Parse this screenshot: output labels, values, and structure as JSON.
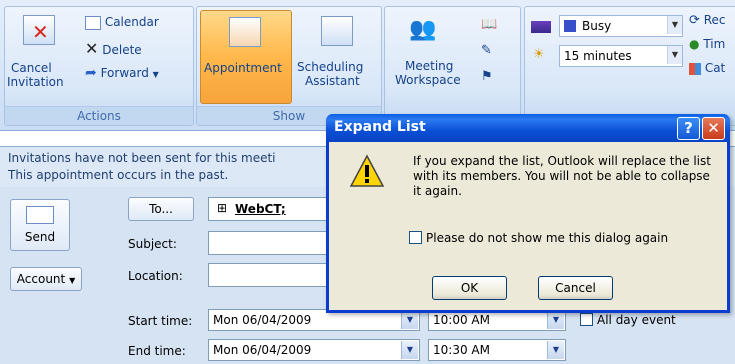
{
  "ribbon": {
    "actions": {
      "cancel_label_1": "Cancel",
      "cancel_label_2": "Invitation",
      "calendar_label": "Calendar",
      "delete_label": "Delete",
      "forward_label": "Forward",
      "group_label": "Actions"
    },
    "show": {
      "appointment_label": "Appointment",
      "scheduling_label_1": "Scheduling",
      "scheduling_label_2": "Assistant",
      "group_label": "Show"
    },
    "attendees": {
      "meeting_label_1": "Meeting",
      "meeting_label_2": "Workspace"
    },
    "options": {
      "show_as": "Busy",
      "reminder": "15 minutes",
      "recurrence_partial": "Rec",
      "timezone_partial": "Tim",
      "categorize_partial": "Cat"
    }
  },
  "infobar": {
    "line1": "Invitations have not been sent for this meeti",
    "line2": "This appointment occurs in the past."
  },
  "form": {
    "send_label": "Send",
    "account_label": "Account",
    "to_button": "To...",
    "to_value": "WebCT;",
    "subject_label": "Subject:",
    "location_label": "Location:",
    "start_label": "Start time:",
    "end_label": "End time:",
    "start_date": "Mon 06/04/2009",
    "start_time": "10:00 AM",
    "end_date": "Mon 06/04/2009",
    "end_time": "10:30 AM",
    "allday_label": "All day event"
  },
  "dialog": {
    "title": "Expand List",
    "message": "If you expand the list, Outlook will replace the list with its members. You will not be able to collapse it again.",
    "checkbox_label": "Please do not show me this dialog again",
    "ok_label": "OK",
    "cancel_label": "Cancel",
    "help_glyph": "?",
    "close_glyph": "✕"
  },
  "colors": {
    "titlebar": "#0a4fd6",
    "ribbon_bg": "#d7e6f7",
    "highlight": "#ffb84a",
    "busy_swatch": "#3550c8"
  }
}
